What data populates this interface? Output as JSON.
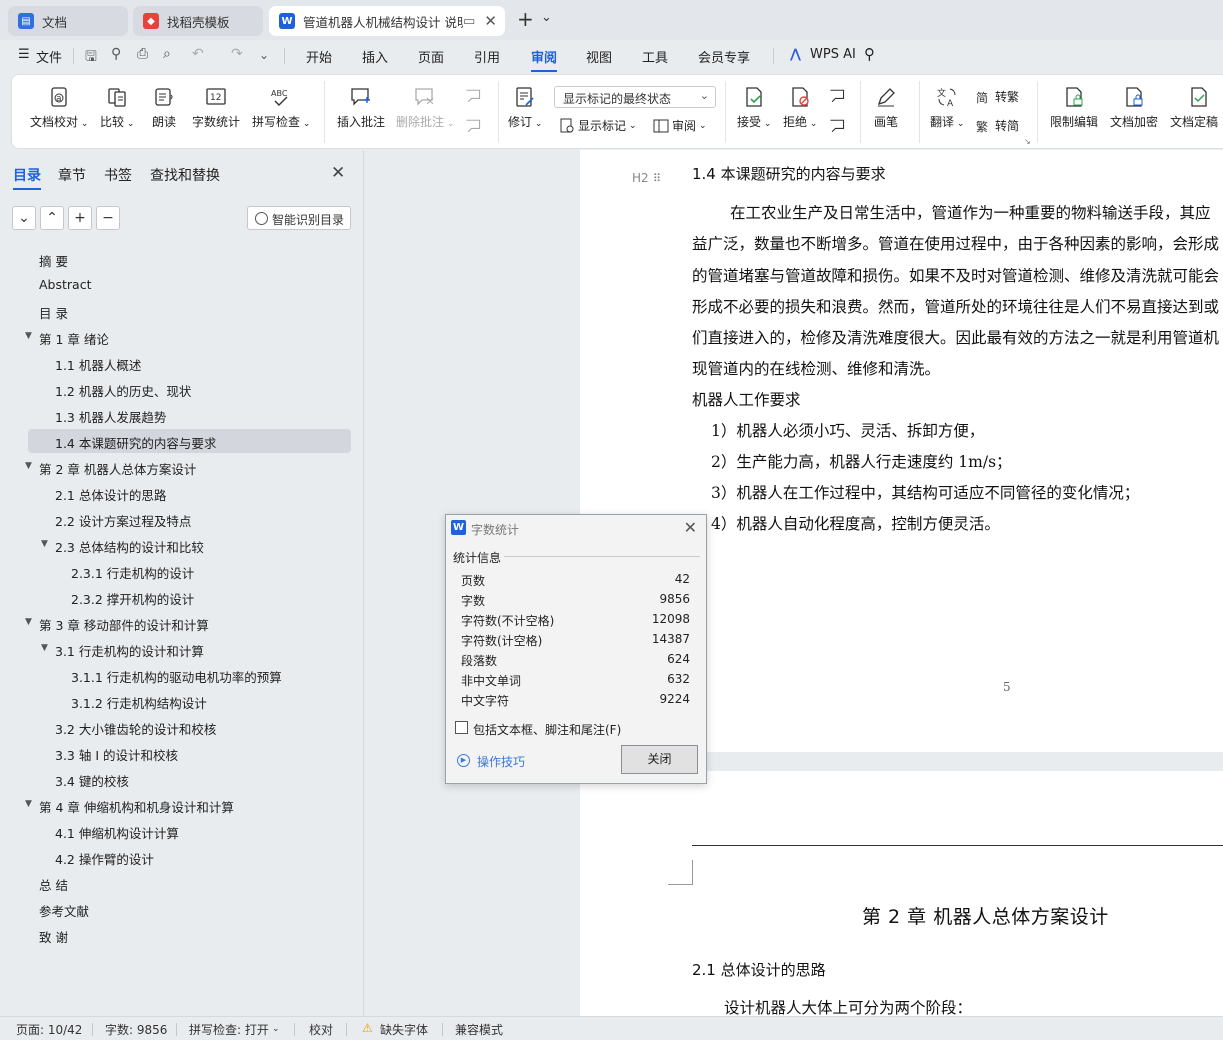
{
  "tabs": [
    {
      "label": "文档",
      "icon": "docs-icon"
    },
    {
      "label": "找稻壳模板",
      "icon": "docer-icon"
    },
    {
      "label": "管道机器人机械结构设计 说明",
      "icon": "wps-writer-icon",
      "active": true
    }
  ],
  "tabbar": {
    "new_tab": "+",
    "dropdown": "⌄"
  },
  "menu": {
    "file": "文件",
    "items": [
      "开始",
      "插入",
      "页面",
      "引用",
      "审阅",
      "视图",
      "工具",
      "会员专享"
    ],
    "active": "审阅",
    "wps_ai": "WPS AI"
  },
  "ribbon": {
    "proofread": "文档校对",
    "compare": "比较",
    "read_aloud": "朗读",
    "word_count": "字数统计",
    "spell_check": "拼写检查",
    "insert_comment": "插入批注",
    "delete_comment": "删除批注",
    "revise": "修订",
    "markup_state": "显示标记的最终状态",
    "show_markup": "显示标记",
    "review_pane": "审阅",
    "accept": "接受",
    "reject": "拒绝",
    "pen": "画笔",
    "translate": "翻译",
    "to_traditional": "转繁",
    "to_simplified": "转简",
    "restrict_edit": "限制编辑",
    "encrypt": "文档加密",
    "finalize": "文档定稿"
  },
  "nav": {
    "tabs": [
      "目录",
      "章节",
      "书签",
      "查找和替换"
    ],
    "active_tab": "目录",
    "smart_toc": "智能识别目录",
    "toc": [
      {
        "text": "摘  要",
        "level": 1
      },
      {
        "text": "Abstract",
        "level": 1
      },
      {
        "text": "目  录",
        "level": 1
      },
      {
        "text": "第 1 章  绪论",
        "level": 1,
        "expanded": true
      },
      {
        "text": "1.1  机器人概述",
        "level": 2
      },
      {
        "text": "1.2  机器人的历史、现状",
        "level": 2
      },
      {
        "text": "1.3 机器人发展趋势",
        "level": 2
      },
      {
        "text": "1.4  本课题研究的内容与要求",
        "level": 2,
        "selected": true
      },
      {
        "text": "第 2 章  机器人总体方案设计",
        "level": 1,
        "expanded": true
      },
      {
        "text": "2.1 总体设计的思路",
        "level": 2
      },
      {
        "text": "2.2  设计方案过程及特点",
        "level": 2
      },
      {
        "text": "2.3  总体结构的设计和比较",
        "level": 2,
        "expanded": true
      },
      {
        "text": "2.3.1  行走机构的设计",
        "level": 3
      },
      {
        "text": "2.3.2  撑开机构的设计",
        "level": 3
      },
      {
        "text": "第 3 章  移动部件的设计和计算",
        "level": 1,
        "expanded": true
      },
      {
        "text": "3.1  行走机构的设计和计算",
        "level": 2,
        "expanded": true
      },
      {
        "text": "3.1.1  行走机构的驱动电机功率的预算",
        "level": 3
      },
      {
        "text": "3.1.2  行走机构结构设计",
        "level": 3
      },
      {
        "text": "3.2 大小锥齿轮的设计和校核",
        "level": 2
      },
      {
        "text": "3.3  轴 I 的设计和校核",
        "level": 2
      },
      {
        "text": "3.4  键的校核",
        "level": 2
      },
      {
        "text": "第 4 章  伸缩机构和机身设计和计算",
        "level": 1,
        "expanded": true
      },
      {
        "text": "4.1  伸缩机构设计计算",
        "level": 2
      },
      {
        "text": "4.2  操作臂的设计",
        "level": 2
      },
      {
        "text": "总  结",
        "level": 1
      },
      {
        "text": "参考文献",
        "level": 1
      },
      {
        "text": "致  谢",
        "level": 1
      }
    ]
  },
  "document": {
    "heading_marker": "H2",
    "section_heading": "1.4  本课题研究的内容与要求",
    "paragraph_lines": [
      "在工农业生产及日常生活中，管道作为一种重要的物料输送手段，其应",
      "益广泛，数量也不断增多。管道在使用过程中，由于各种因素的影响，会形成",
      "的管道堵塞与管道故障和损伤。如果不及时对管道检测、维修及清洗就可能会",
      "形成不必要的损失和浪费。然而，管道所处的环境往往是人们不易直接达到或",
      "们直接进入的，检修及清洗难度很大。因此最有效的方法之一就是利用管道机",
      "现管道内的在线检测、维修和清洗。"
    ],
    "requirements_title": "机器人工作要求",
    "requirements": [
      "1）机器人必须小巧、灵活、拆卸方便，",
      "2）生产能力高，机器人行走速度约 1m/s；",
      "3）机器人在工作过程中，其结构可适应不同管径的变化情况；",
      "4）机器人自动化程度高，控制方便灵活。"
    ],
    "page_number": "5",
    "chapter_heading": "第 2 章  机器人总体方案设计",
    "subheading": "2.1 总体设计的思路",
    "body_start": "设计机器人大体上可分为两个阶段："
  },
  "dialog": {
    "title": "字数统计",
    "group": "统计信息",
    "stats": [
      {
        "label": "页数",
        "value": "42"
      },
      {
        "label": "字数",
        "value": "9856"
      },
      {
        "label": "字符数(不计空格)",
        "value": "12098"
      },
      {
        "label": "字符数(计空格)",
        "value": "14387"
      },
      {
        "label": "段落数",
        "value": "624"
      },
      {
        "label": "非中文单词",
        "value": "632"
      },
      {
        "label": "中文字符",
        "value": "9224"
      }
    ],
    "include_label": "包括文本框、脚注和尾注(F)",
    "tips": "操作技巧",
    "close": "关闭"
  },
  "status": {
    "page": "页面: 10/42",
    "words": "字数: 9856",
    "spell": "拼写检查: 打开",
    "proof": "校对",
    "missing_font": "缺失字体",
    "compat": "兼容模式"
  },
  "colors": {
    "accent": "#1d62d8",
    "docer_red": "#e8423c",
    "warning": "#e6a100"
  }
}
